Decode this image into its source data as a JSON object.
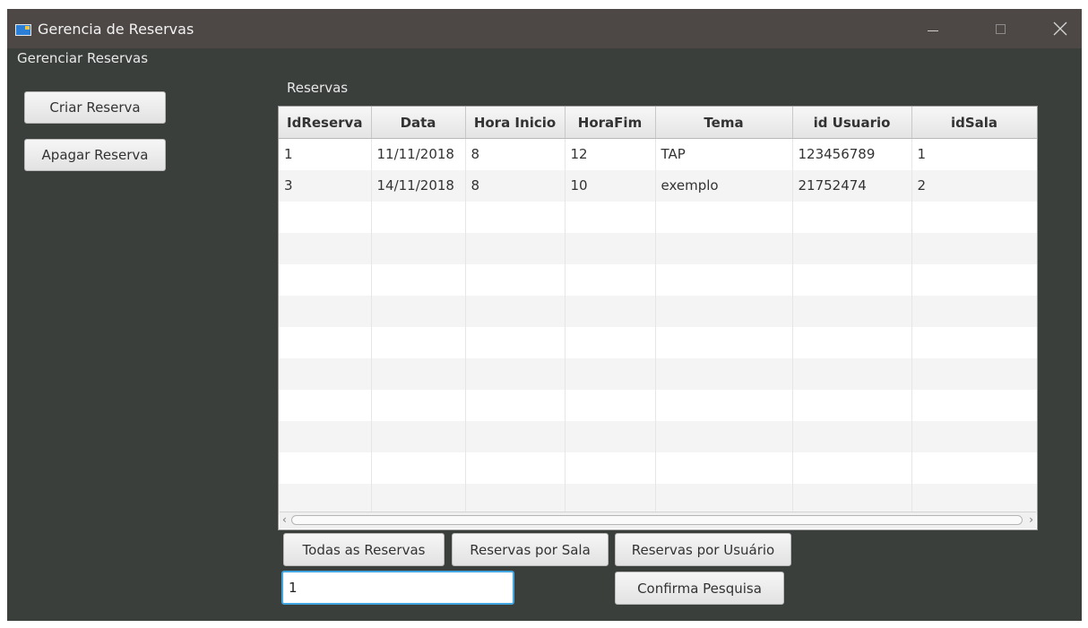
{
  "window": {
    "title": "Gerencia de Reservas",
    "controls": {
      "minimize": "minimize-icon",
      "maximize": "maximize-icon",
      "close": "close-icon"
    }
  },
  "sidebar": {
    "title": "Gerenciar Reservas",
    "create_label": "Criar Reserva",
    "delete_label": "Apagar Reserva"
  },
  "main": {
    "table_label": "Reservas",
    "columns": [
      "IdReserva",
      "Data",
      "Hora Inicio",
      "HoraFim",
      "Tema",
      "id Usuario",
      "idSala"
    ],
    "rows": [
      [
        "1",
        "11/11/2018",
        "8",
        "12",
        "TAP",
        "123456789",
        "1"
      ],
      [
        "3",
        "14/11/2018",
        "8",
        "10",
        "exemplo",
        "21752474",
        "2"
      ]
    ]
  },
  "filters": {
    "all_label": "Todas as Reservas",
    "by_room_label": "Reservas por Sala",
    "by_user_label": "Reservas por Usuário",
    "confirm_label": "Confirma Pesquisa",
    "search_value": "1"
  },
  "colors": {
    "window_bg": "#3a3f3c",
    "titlebar_bg": "#4d4846",
    "focus_accent": "#43a6e0"
  }
}
